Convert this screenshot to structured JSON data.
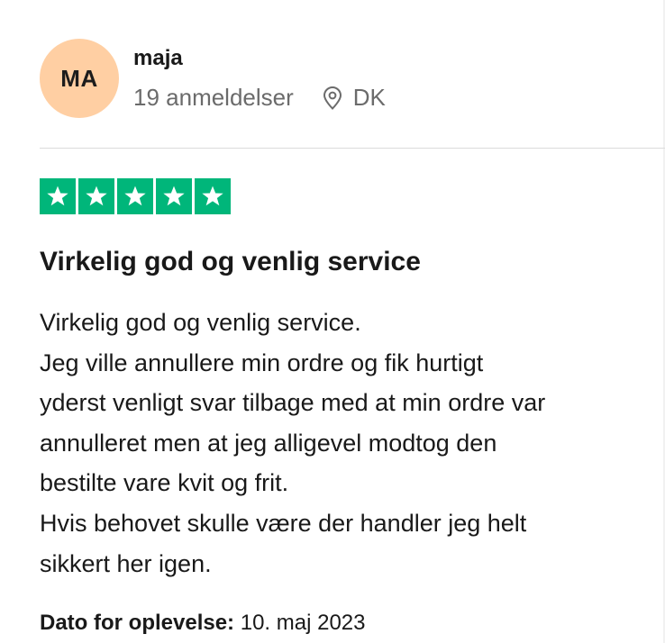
{
  "reviewer": {
    "initials": "MA",
    "name": "maja",
    "reviews_count": "19 anmeldelser",
    "country": "DK",
    "location_icon": "map-pin-icon",
    "avatar_color": "#ffcfa3"
  },
  "rating": {
    "stars": 5,
    "max": 5,
    "color": "#00b67a",
    "icon": "star-icon"
  },
  "review": {
    "title": "Virkelig god og venlig service",
    "lines": [
      "Virkelig god og venlig service.",
      "Jeg ville annullere min ordre og fik hurtigt",
      "yderst venligt svar tilbage med at min ordre var",
      "annulleret men at jeg alligevel modtog den",
      "bestilte vare kvit og frit.",
      "Hvis behovet skulle være der handler jeg helt",
      "sikkert her igen."
    ]
  },
  "experience": {
    "label": "Dato for oplevelse:",
    "date": "10. maj 2023"
  }
}
